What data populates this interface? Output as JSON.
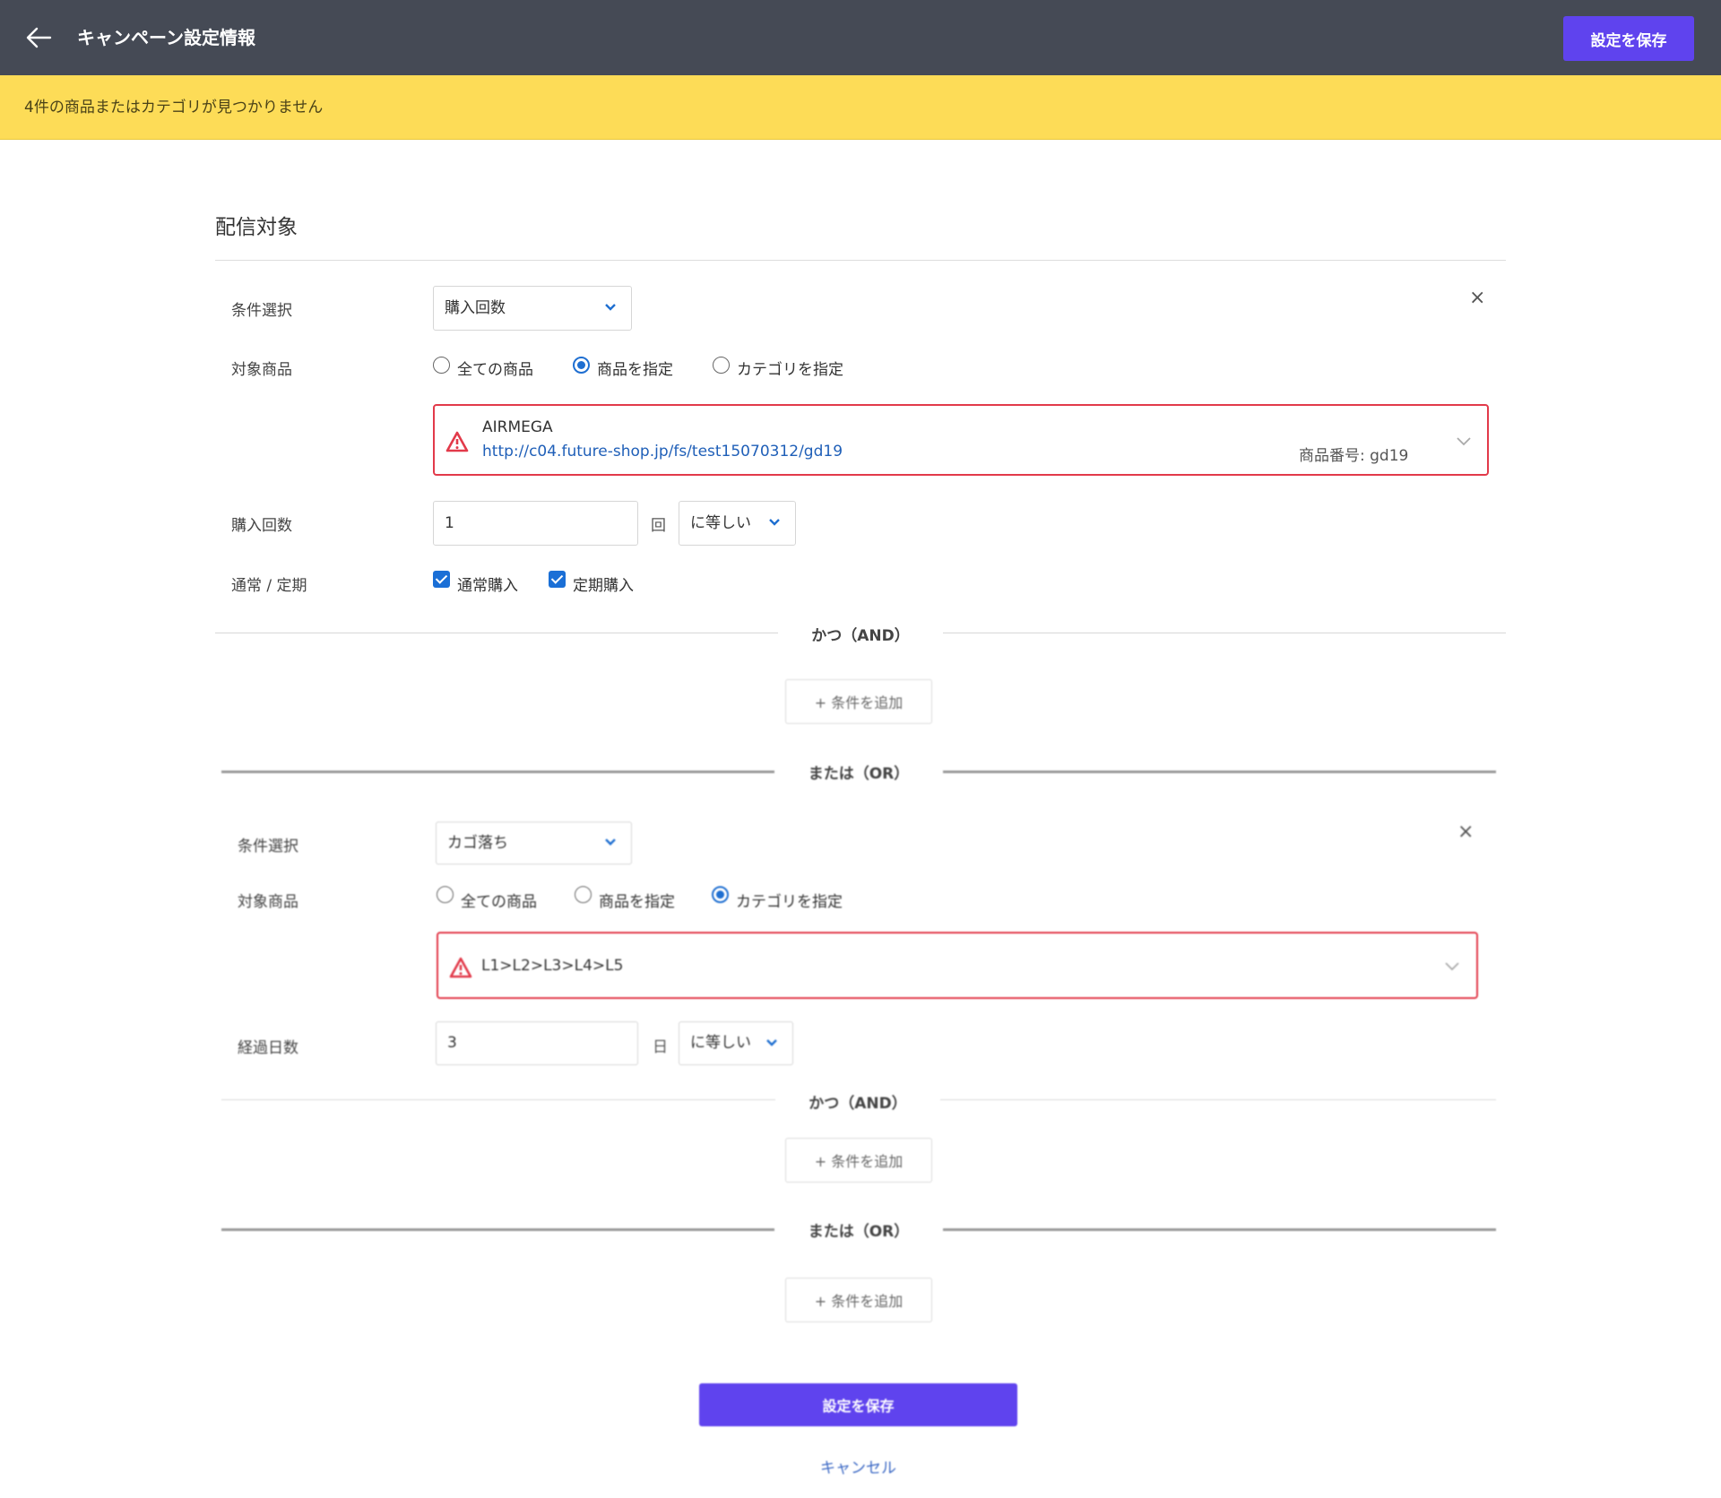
{
  "header": {
    "title": "キャンペーン設定情報",
    "save_label": "設定を保存"
  },
  "alert": {
    "message": "4件の商品またはカテゴリが見つかりません"
  },
  "section": {
    "title": "配信対象"
  },
  "labels": {
    "condition_select": "条件選択",
    "target_product": "対象商品",
    "purchase_count": "購入回数",
    "normal_regular": "通常 / 定期",
    "elapsed_days": "経過日数"
  },
  "options": {
    "all_products": "全ての商品",
    "specify_product": "商品を指定",
    "specify_category": "カテゴリを指定"
  },
  "condition1": {
    "type": "購入回数",
    "target": "specify_product",
    "item": {
      "name": "AIRMEGA",
      "url": "http://c04.future-shop.jp/fs/test15070312/gd19",
      "code": "商品番号: gd19"
    },
    "count_value": "1",
    "count_unit": "回",
    "comparator": "に等しい",
    "normal_purchase": "通常購入",
    "regular_purchase": "定期購入"
  },
  "condition2": {
    "type": "カゴ落ち",
    "target": "specify_category",
    "category_path": "L1>L2>L3>L4>L5",
    "days_value": "3",
    "days_unit": "日",
    "comparator": "に等しい"
  },
  "connectors": {
    "and": "かつ（AND）",
    "or": "または（OR）",
    "add_condition": "+ 条件を追加"
  },
  "footer": {
    "save_label": "設定を保存",
    "cancel_label": "キャンセル"
  },
  "colors": {
    "header_bg": "#454a55",
    "primary": "#5f43ee",
    "alert_bg": "#fddc57",
    "error": "#e23a4a",
    "link": "#1f5fb8"
  }
}
